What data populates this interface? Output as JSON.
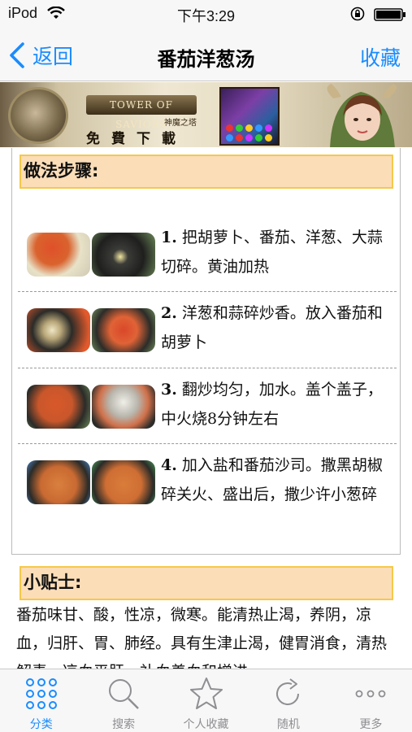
{
  "status_bar": {
    "carrier": "iPod",
    "time": "下午3:29"
  },
  "nav": {
    "back_label": "返回",
    "title": "番茄洋葱汤",
    "favorite_label": "收藏"
  },
  "ad": {
    "logo_text": "TOWER OF SAVIORS",
    "logo_sub": "神魔之塔",
    "cta": "免費下載"
  },
  "steps_section": {
    "heading": "做法步骤:",
    "steps": [
      {
        "num": "1.",
        "text": " 把胡萝卜、番茄、洋葱、大蒜切碎。黄油加热"
      },
      {
        "num": "2.",
        "text": " 洋葱和蒜碎炒香。放入番茄和胡萝卜"
      },
      {
        "num": "3.",
        "text": " 翻炒均匀，加水。盖个盖子，中火烧8分钟左右"
      },
      {
        "num": "4.",
        "text": " 加入盐和番茄沙司。撒黑胡椒碎关火、盛出后，撒少许小葱碎"
      }
    ]
  },
  "tips_section": {
    "heading": "小贴士:",
    "text": "番茄味甘、酸，性凉，微寒。能清热止渴，养阴，凉血，归肝、胃、肺经。具有生津止渴，健胃消食，清热解毒，凉血平肝，补血养血和增进"
  },
  "tabs": [
    {
      "label": "分类",
      "icon": "grid-icon",
      "active": true
    },
    {
      "label": "搜索",
      "icon": "search-icon",
      "active": false
    },
    {
      "label": "个人收藏",
      "icon": "star-icon",
      "active": false
    },
    {
      "label": "随机",
      "icon": "refresh-icon",
      "active": false
    },
    {
      "label": "更多",
      "icon": "more-icon",
      "active": false
    }
  ],
  "colors": {
    "accent": "#1a8cff",
    "section_bg": "#fbddb8",
    "section_border": "#f5c84a"
  }
}
